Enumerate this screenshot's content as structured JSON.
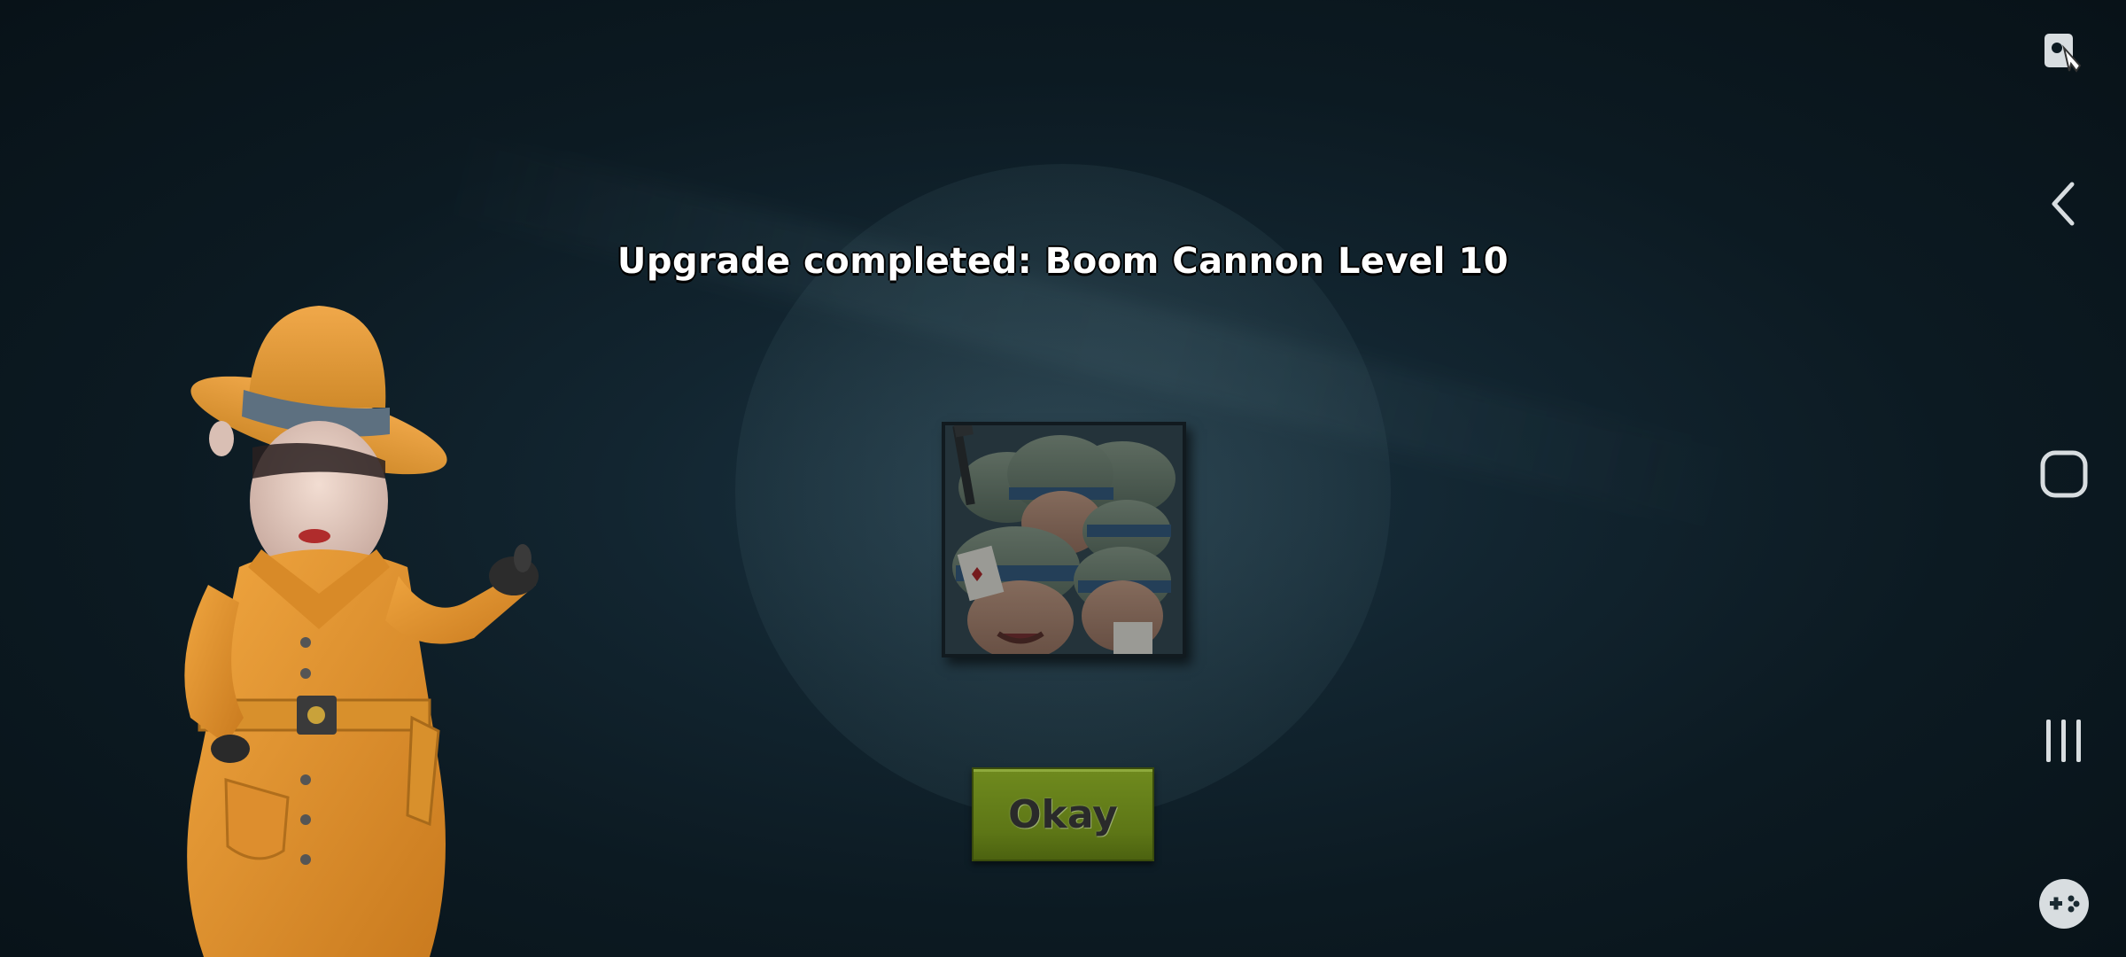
{
  "dialog": {
    "title": "Upgrade completed: Boom Cannon Level 10",
    "okay_label": "Okay",
    "unit_icon": "heavy-troops-portrait"
  },
  "character": {
    "icon": "spy-character-orange-coat"
  },
  "nav": {
    "items": [
      {
        "name": "screenshot-touch-icon"
      },
      {
        "name": "back-icon"
      },
      {
        "name": "home-icon"
      },
      {
        "name": "recent-apps-icon"
      },
      {
        "name": "game-controller-icon"
      }
    ]
  },
  "colors": {
    "background": "#0c1a22",
    "okay_button": "#6f8a1e",
    "title_text": "#ffffff",
    "coat": "#e0922e"
  }
}
